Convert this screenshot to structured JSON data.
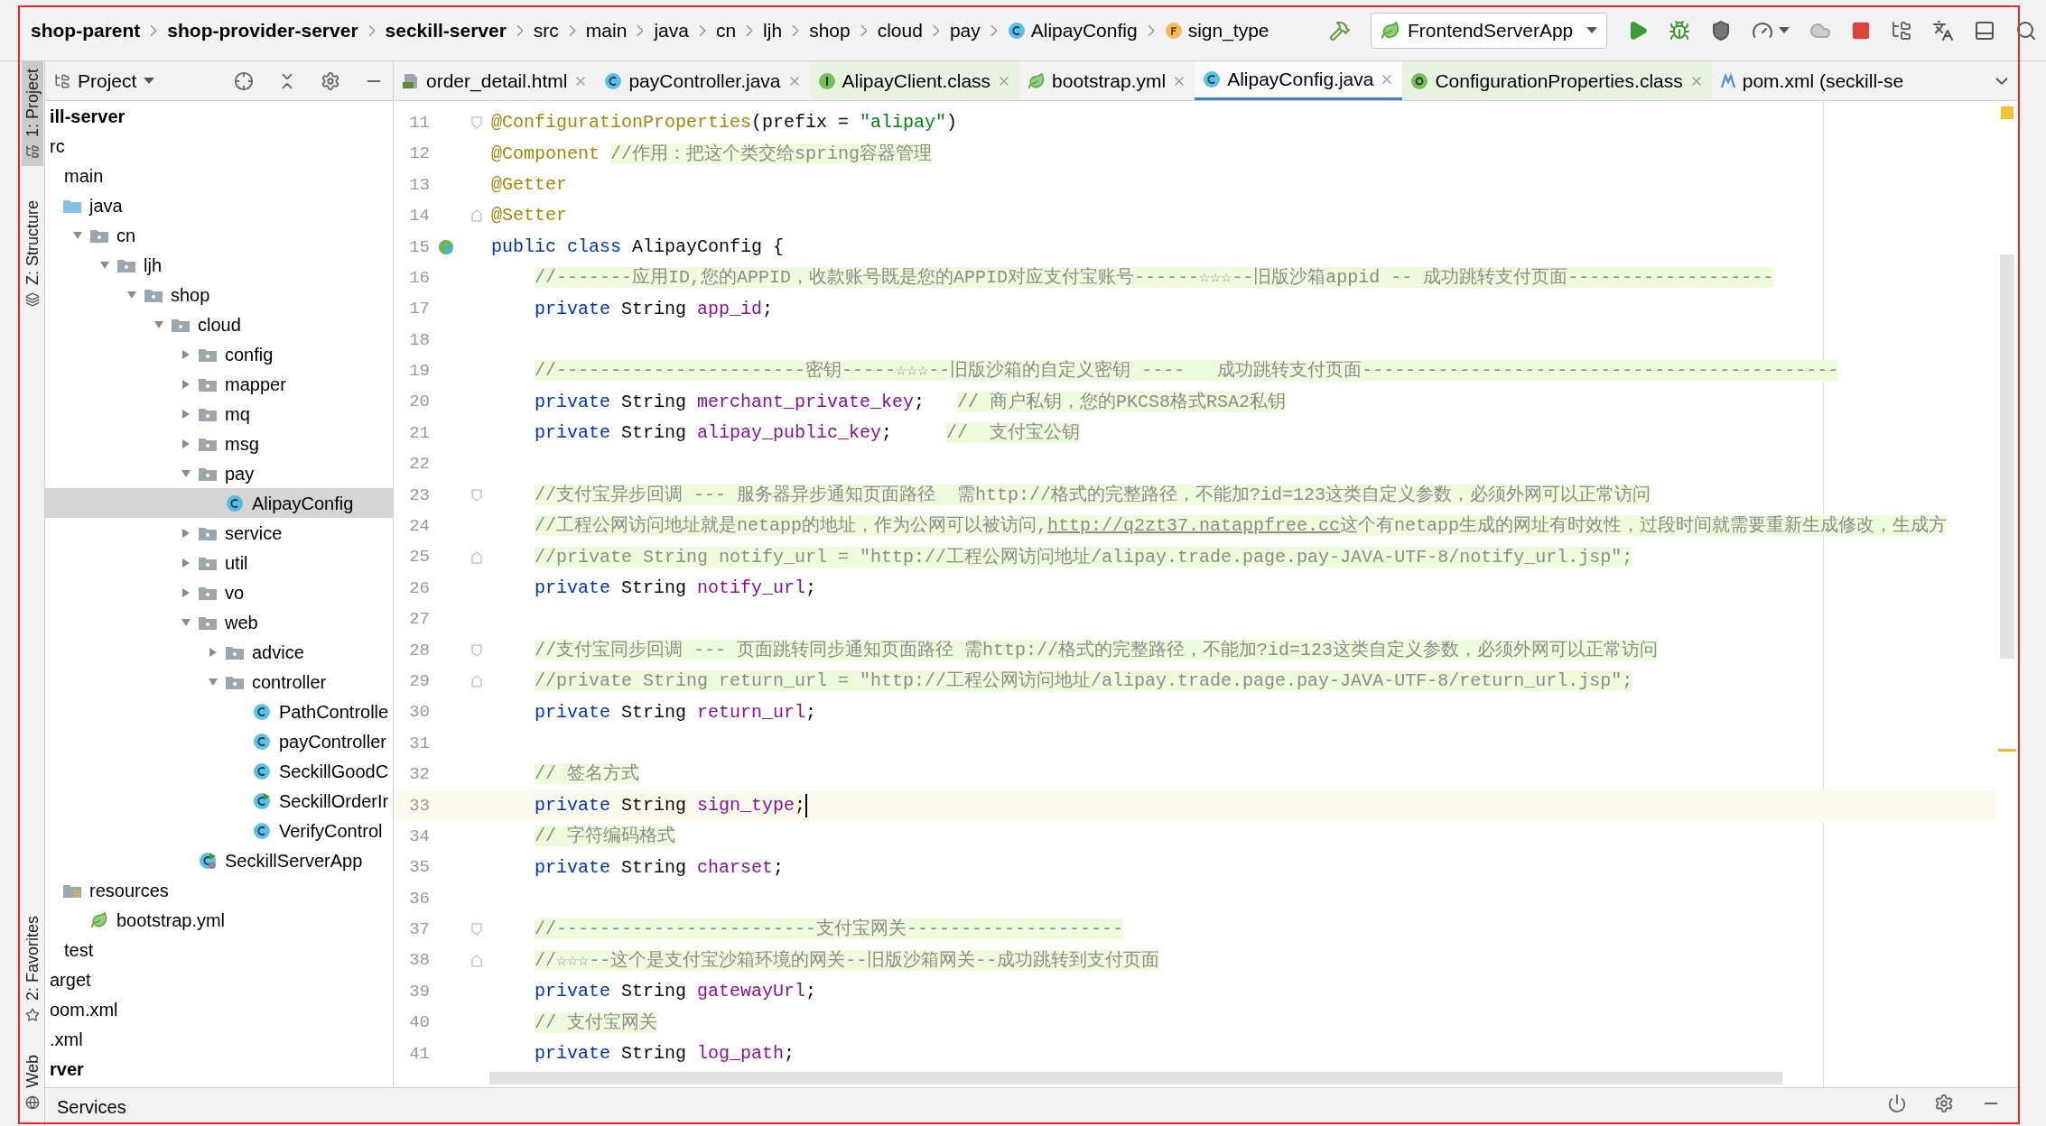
{
  "breadcrumbs": [
    {
      "label": "shop-parent",
      "kind": "module"
    },
    {
      "label": "shop-provider-server",
      "kind": "module"
    },
    {
      "label": "seckill-server",
      "kind": "module"
    },
    {
      "label": "src",
      "kind": "folder"
    },
    {
      "label": "main",
      "kind": "folder"
    },
    {
      "label": "java",
      "kind": "folder"
    },
    {
      "label": "cn",
      "kind": "folder"
    },
    {
      "label": "ljh",
      "kind": "folder"
    },
    {
      "label": "shop",
      "kind": "folder"
    },
    {
      "label": "cloud",
      "kind": "folder"
    },
    {
      "label": "pay",
      "kind": "folder"
    },
    {
      "label": "AlipayConfig",
      "kind": "class"
    },
    {
      "label": "sign_type",
      "kind": "field"
    }
  ],
  "run_configuration": "FrontendServerApp",
  "left_stripe": {
    "top": [
      {
        "label": "1: Project",
        "selected": true
      },
      {
        "label": "Z: Structure",
        "selected": false
      }
    ],
    "bottom": [
      {
        "label": "2: Favorites",
        "selected": false
      },
      {
        "label": "Web",
        "selected": false
      }
    ]
  },
  "project_panel": {
    "title": "Project"
  },
  "project_tree": [
    {
      "label": "ill-server",
      "kind": "module",
      "selected": false,
      "children": [
        {
          "label": "rc",
          "kind": "plain",
          "selected": false,
          "children": [
            {
              "label": "main",
              "kind": "plain",
              "selected": false,
              "children": [
                {
                  "label": "java",
                  "kind": "source-folder",
                  "selected": false,
                  "children": [
                    {
                      "label": "cn",
                      "kind": "folder",
                      "expanded": true,
                      "selected": false,
                      "children": [
                        {
                          "label": "ljh",
                          "kind": "folder",
                          "expanded": true,
                          "selected": false,
                          "children": [
                            {
                              "label": "shop",
                              "kind": "folder",
                              "expanded": true,
                              "selected": false,
                              "children": [
                                {
                                  "label": "cloud",
                                  "kind": "folder",
                                  "expanded": true,
                                  "selected": false,
                                  "children": [
                                    {
                                      "label": "config",
                                      "kind": "folder",
                                      "expanded": false,
                                      "selected": false
                                    },
                                    {
                                      "label": "mapper",
                                      "kind": "folder",
                                      "expanded": false,
                                      "selected": false
                                    },
                                    {
                                      "label": "mq",
                                      "kind": "folder",
                                      "expanded": false,
                                      "selected": false
                                    },
                                    {
                                      "label": "msg",
                                      "kind": "folder",
                                      "expanded": false,
                                      "selected": false
                                    },
                                    {
                                      "label": "pay",
                                      "kind": "folder",
                                      "expanded": true,
                                      "selected": false,
                                      "children": [
                                        {
                                          "label": "AlipayConfig",
                                          "kind": "class",
                                          "selected": true
                                        }
                                      ]
                                    },
                                    {
                                      "label": "service",
                                      "kind": "folder",
                                      "expanded": false,
                                      "selected": false
                                    },
                                    {
                                      "label": "util",
                                      "kind": "folder",
                                      "expanded": false,
                                      "selected": false
                                    },
                                    {
                                      "label": "vo",
                                      "kind": "folder",
                                      "expanded": false,
                                      "selected": false
                                    },
                                    {
                                      "label": "web",
                                      "kind": "folder",
                                      "expanded": true,
                                      "selected": false,
                                      "children": [
                                        {
                                          "label": "advice",
                                          "kind": "folder",
                                          "expanded": false,
                                          "selected": false
                                        },
                                        {
                                          "label": "controller",
                                          "kind": "folder",
                                          "expanded": true,
                                          "selected": false,
                                          "children": [
                                            {
                                              "label": "PathControlle",
                                              "kind": "class",
                                              "selected": false
                                            },
                                            {
                                              "label": "payController",
                                              "kind": "class",
                                              "selected": false
                                            },
                                            {
                                              "label": "SeckillGoodC",
                                              "kind": "class",
                                              "selected": false
                                            },
                                            {
                                              "label": "SeckillOrderIr",
                                              "kind": "run-class",
                                              "selected": false
                                            },
                                            {
                                              "label": "VerifyControl",
                                              "kind": "class",
                                              "selected": false
                                            }
                                          ]
                                        }
                                      ]
                                    },
                                    {
                                      "label": "SeckillServerApp",
                                      "kind": "app",
                                      "selected": false
                                    }
                                  ]
                                }
                              ]
                            }
                          ]
                        }
                      ]
                    }
                  ]
                },
                {
                  "label": "resources",
                  "kind": "resources",
                  "selected": false,
                  "children": [
                    {
                      "label": "bootstrap.yml",
                      "kind": "yml",
                      "selected": false
                    }
                  ]
                }
              ]
            },
            {
              "label": "test",
              "kind": "plain",
              "selected": false
            }
          ]
        },
        {
          "label": "arget",
          "kind": "plain",
          "selected": false
        },
        {
          "label": "oom.xml",
          "kind": "plain",
          "selected": false
        },
        {
          "label": ".xml",
          "kind": "plain",
          "selected": false
        }
      ]
    },
    {
      "label": "rver",
      "kind": "module",
      "selected": false
    }
  ],
  "tabs": [
    {
      "label": "order_detail.html",
      "kind": "html",
      "selected": false,
      "closable": true
    },
    {
      "label": "payController.java",
      "kind": "class",
      "selected": false,
      "closable": true
    },
    {
      "label": "AlipayClient.class",
      "kind": "interface",
      "selected": false,
      "closable": true
    },
    {
      "label": "bootstrap.yml",
      "kind": "yml",
      "selected": false,
      "closable": true
    },
    {
      "label": "AlipayConfig.java",
      "kind": "class",
      "selected": true,
      "closable": true
    },
    {
      "label": "ConfigurationProperties.class",
      "kind": "annotation",
      "selected": false,
      "closable": true
    },
    {
      "label": "pom.xml (seckill-se",
      "kind": "maven",
      "selected": false,
      "closable": false
    }
  ],
  "code_lines": [
    {
      "number": "11",
      "fold_start": true,
      "tokens": [
        {
          "kind": "annotation",
          "text": "@ConfigurationProperties"
        },
        {
          "kind": "plain",
          "text": "(prefix = "
        },
        {
          "kind": "string",
          "text": "\"alipay\""
        },
        {
          "kind": "plain",
          "text": ")"
        }
      ]
    },
    {
      "number": "12",
      "tokens": [
        {
          "kind": "annotation",
          "text": "@Component "
        },
        {
          "kind": "comment",
          "text": "//作用：把这个类交给spring容器管理"
        }
      ]
    },
    {
      "number": "13",
      "tokens": [
        {
          "kind": "annotation",
          "text": "@Getter"
        }
      ]
    },
    {
      "number": "14",
      "fold_end": true,
      "tokens": [
        {
          "kind": "annotation",
          "text": "@Setter"
        }
      ]
    },
    {
      "number": "15",
      "bean": true,
      "tokens": [
        {
          "kind": "keyword",
          "text": "public class "
        },
        {
          "kind": "plain",
          "text": "AlipayConfig {"
        }
      ]
    },
    {
      "number": "16",
      "indented": true,
      "tokens": [
        {
          "kind": "comment",
          "text": "//-------应用ID,您的APPID，收款账号既是您的APPID对应支付宝账号------☆☆☆--旧版沙箱appid -- 成功跳转支付页面-------------------"
        }
      ]
    },
    {
      "number": "17",
      "indented": true,
      "tokens": [
        {
          "kind": "keyword",
          "text": "private "
        },
        {
          "kind": "plain",
          "text": "String "
        },
        {
          "kind": "field",
          "text": "app_id"
        },
        {
          "kind": "plain",
          "text": ";"
        }
      ]
    },
    {
      "number": "18"
    },
    {
      "number": "19",
      "indented": true,
      "tokens": [
        {
          "kind": "comment",
          "text": "//-----------------------密钥-----☆☆☆--旧版沙箱的自定义密钥 ----   成功跳转支付页面--------------------------------------------"
        }
      ]
    },
    {
      "number": "20",
      "indented": true,
      "tokens": [
        {
          "kind": "keyword",
          "text": "private "
        },
        {
          "kind": "plain",
          "text": "String "
        },
        {
          "kind": "field",
          "text": "merchant_private_key"
        },
        {
          "kind": "plain",
          "text": ";   "
        },
        {
          "kind": "comment",
          "text": "// 商户私钥，您的PKCS8格式RSA2私钥"
        }
      ]
    },
    {
      "number": "21",
      "indented": true,
      "tokens": [
        {
          "kind": "keyword",
          "text": "private "
        },
        {
          "kind": "plain",
          "text": "String "
        },
        {
          "kind": "field",
          "text": "alipay_public_key"
        },
        {
          "kind": "plain",
          "text": ";     "
        },
        {
          "kind": "comment",
          "text": "//  支付宝公钥"
        }
      ]
    },
    {
      "number": "22"
    },
    {
      "number": "23",
      "fold_start": true,
      "indented": true,
      "tokens": [
        {
          "kind": "comment",
          "text": "//支付宝异步回调 --- 服务器异步通知页面路径  需http://格式的完整路径，不能加?id=123这类自定义参数，必须外网可以正常访问"
        }
      ]
    },
    {
      "number": "24",
      "indented": true,
      "tokens": [
        {
          "kind": "comment",
          "text": "//工程公网访问地址就是netapp的地址，作为公网可以被访问,"
        },
        {
          "kind": "comment-link",
          "text": "http://q2zt37.natappfree.cc"
        },
        {
          "kind": "comment",
          "text": "这个有netapp生成的网址有时效性，过段时间就需要重新生成修改，生成方"
        }
      ]
    },
    {
      "number": "25",
      "fold_end": true,
      "indented": true,
      "tokens": [
        {
          "kind": "comment",
          "text": "//private String notify_url = \"http://工程公网访问地址/alipay.trade.page.pay-JAVA-UTF-8/notify_url.jsp\";"
        }
      ]
    },
    {
      "number": "26",
      "indented": true,
      "tokens": [
        {
          "kind": "keyword",
          "text": "private "
        },
        {
          "kind": "plain",
          "text": "String "
        },
        {
          "kind": "field",
          "text": "notify_url"
        },
        {
          "kind": "plain",
          "text": ";"
        }
      ]
    },
    {
      "number": "27"
    },
    {
      "number": "28",
      "fold_start": true,
      "indented": true,
      "tokens": [
        {
          "kind": "comment",
          "text": "//支付宝同步回调 --- 页面跳转同步通知页面路径 需http://格式的完整路径，不能加?id=123这类自定义参数，必须外网可以正常访问"
        }
      ]
    },
    {
      "number": "29",
      "fold_end": true,
      "indented": true,
      "tokens": [
        {
          "kind": "comment",
          "text": "//private String return_url = \"http://工程公网访问地址/alipay.trade.page.pay-JAVA-UTF-8/return_url.jsp\";"
        }
      ]
    },
    {
      "number": "30",
      "indented": true,
      "tokens": [
        {
          "kind": "keyword",
          "text": "private "
        },
        {
          "kind": "plain",
          "text": "String "
        },
        {
          "kind": "field",
          "text": "return_url"
        },
        {
          "kind": "plain",
          "text": ";"
        }
      ]
    },
    {
      "number": "31"
    },
    {
      "number": "32",
      "indented": true,
      "tokens": [
        {
          "kind": "comment",
          "text": "// 签名方式"
        }
      ]
    },
    {
      "number": "33",
      "current": true,
      "indented": true,
      "tokens": [
        {
          "kind": "keyword",
          "text": "private "
        },
        {
          "kind": "plain",
          "text": "String "
        },
        {
          "kind": "field",
          "text": "sign_type"
        },
        {
          "kind": "plain",
          "text": ";"
        }
      ]
    },
    {
      "number": "34",
      "indented": true,
      "tokens": [
        {
          "kind": "comment",
          "text": "// 字符编码格式"
        }
      ]
    },
    {
      "number": "35",
      "indented": true,
      "tokens": [
        {
          "kind": "keyword",
          "text": "private "
        },
        {
          "kind": "plain",
          "text": "String "
        },
        {
          "kind": "field",
          "text": "charset"
        },
        {
          "kind": "plain",
          "text": ";"
        }
      ]
    },
    {
      "number": "36"
    },
    {
      "number": "37",
      "fold_start": true,
      "indented": true,
      "tokens": [
        {
          "kind": "comment",
          "text": "//------------------------支付宝网关--------------------"
        }
      ]
    },
    {
      "number": "38",
      "fold_end": true,
      "indented": true,
      "tokens": [
        {
          "kind": "comment",
          "text": "//☆☆☆--这个是支付宝沙箱环境的网关--旧版沙箱网关--成功跳转到支付页面"
        }
      ]
    },
    {
      "number": "39",
      "indented": true,
      "tokens": [
        {
          "kind": "keyword",
          "text": "private "
        },
        {
          "kind": "plain",
          "text": "String "
        },
        {
          "kind": "field",
          "text": "gatewayUrl"
        },
        {
          "kind": "plain",
          "text": ";"
        }
      ]
    },
    {
      "number": "40",
      "indented": true,
      "tokens": [
        {
          "kind": "comment",
          "text": "// 支付宝网关"
        }
      ]
    },
    {
      "number": "41",
      "indented": true,
      "tokens": [
        {
          "kind": "keyword",
          "text": "private "
        },
        {
          "kind": "plain",
          "text": "String "
        },
        {
          "kind": "field",
          "text": "log_path"
        },
        {
          "kind": "plain",
          "text": ";"
        }
      ]
    }
  ],
  "bottom_bar": {
    "label": "Services"
  }
}
